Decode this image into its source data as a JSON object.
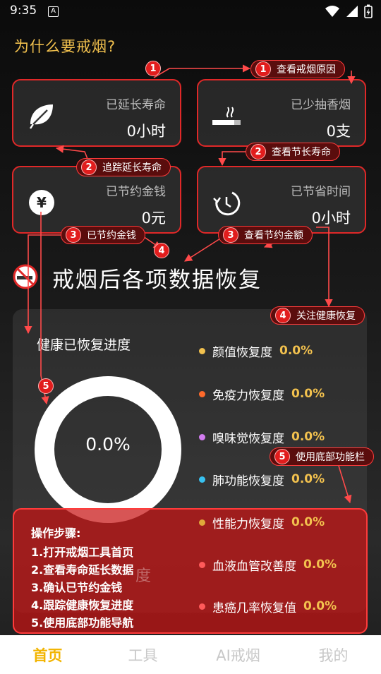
{
  "status_bar": {
    "time": "9:35",
    "notif_glyph": "A"
  },
  "why_title": "为什么要戒烟?",
  "cards": [
    {
      "label": "已延长寿命",
      "value": "0小时",
      "icon": "leaf-icon"
    },
    {
      "label": "已少抽香烟",
      "value": "0支",
      "icon": "cigarette-icon"
    },
    {
      "label": "已节约金钱",
      "value": "0元",
      "icon": "yen-icon"
    },
    {
      "label": "已节省时间",
      "value": "0小时",
      "icon": "clock-icon"
    }
  ],
  "annotations": {
    "a1": {
      "num": "1",
      "text": "查看戒烟原因"
    },
    "a2": {
      "num": "2",
      "text": "追踪延长寿命"
    },
    "a2b": {
      "num": "2",
      "text": "查看节长寿命"
    },
    "a3": {
      "num": "3",
      "text": "已节约金钱"
    },
    "a3b": {
      "num": "3",
      "text": "查看节约金额"
    },
    "a4": {
      "num": "4",
      "text": "关注健康恢复"
    },
    "a5": {
      "num": "5",
      "text": "使用底部功能栏"
    },
    "badge1": "1",
    "badge4": "4",
    "badge5": "5"
  },
  "section_title": "戒烟后各项数据恢复",
  "progress": {
    "title": "健康已恢复进度",
    "value_text": "0.0%",
    "fraction": 0.0
  },
  "metrics": [
    {
      "label": "颜值恢复度",
      "value": "0.0%",
      "color": "#f2c14e"
    },
    {
      "label": "免疫力恢复度",
      "value": "0.0%",
      "color": "#ff6a2b"
    },
    {
      "label": "嗅味觉恢复度",
      "value": "0.0%",
      "color": "#d27cf0"
    },
    {
      "label": "肺功能恢复度",
      "value": "0.0%",
      "color": "#38c1f0"
    },
    {
      "label": "性能力恢复度",
      "value": "0.0%",
      "color": "#e0a83a"
    },
    {
      "label": "血液血管改善度",
      "value": "0.0%",
      "color": "#ff5a5a"
    },
    {
      "label": "患癌几率恢复值",
      "value": "0.0%",
      "color": "#ff5a5a"
    }
  ],
  "steps": {
    "title": "操作步骤:",
    "items": [
      "1.打开戒烟工具首页",
      "2.查看寿命延长数据",
      "3.确认已节约金钱",
      "4.跟踪健康恢复进度",
      "5.使用底部功能导航"
    ],
    "ghost": "度"
  },
  "bottom_nav": [
    {
      "label": "首页",
      "active": true
    },
    {
      "label": "工具",
      "active": false
    },
    {
      "label": "AI戒烟",
      "active": false
    },
    {
      "label": "我的",
      "active": false
    }
  ],
  "colors": {
    "accent_red": "#e02828",
    "gold": "#f2c14e"
  }
}
